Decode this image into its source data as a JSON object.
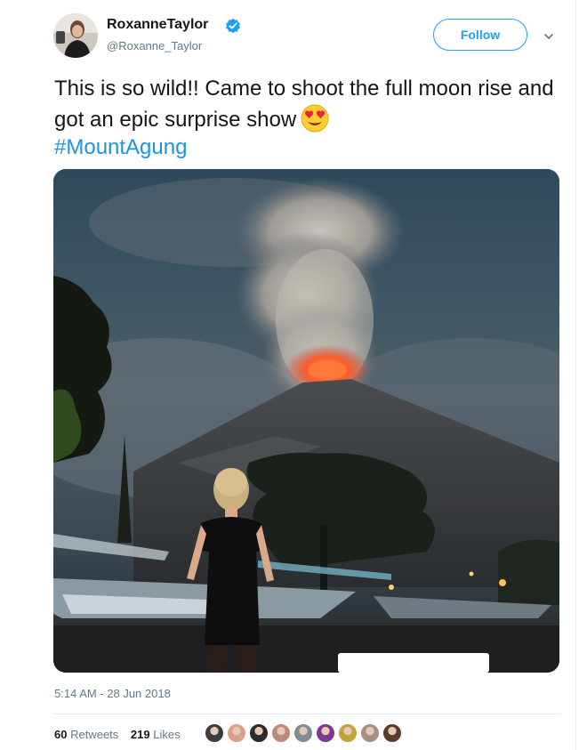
{
  "user": {
    "display_name": "RoxanneTaylor",
    "handle": "@Roxanne_Taylor",
    "verified_icon": "verified-badge-icon",
    "avatar_icon": "user-avatar"
  },
  "follow_button": {
    "label": "Follow"
  },
  "more_menu": {
    "icon": "chevron-down-icon"
  },
  "tweet": {
    "text": "This is so wild!! Came to shoot the full moon rise and got an epic surprise show",
    "emoji": "heart-eyes-emoji",
    "hashtag": "#MountAgung"
  },
  "photo": {
    "icon": "tweet-photo"
  },
  "meta": {
    "timestamp": "5:14 AM - 28 Jun 2018"
  },
  "stats": {
    "retweets_count": "60",
    "retweets_label": "Retweets",
    "likes_count": "219",
    "likes_label": "Likes"
  },
  "likers": {
    "colors": [
      "#3d3d3d",
      "#d9a08c",
      "#2b2b2b",
      "#b98b7a",
      "#7f8b96",
      "#7d3a8c",
      "#c2a23a",
      "#a58e83",
      "#5a3d2e"
    ]
  },
  "colors": {
    "accent": "#1da1f2",
    "hashtag": "#1b95e0",
    "secondary_text": "#657786"
  }
}
